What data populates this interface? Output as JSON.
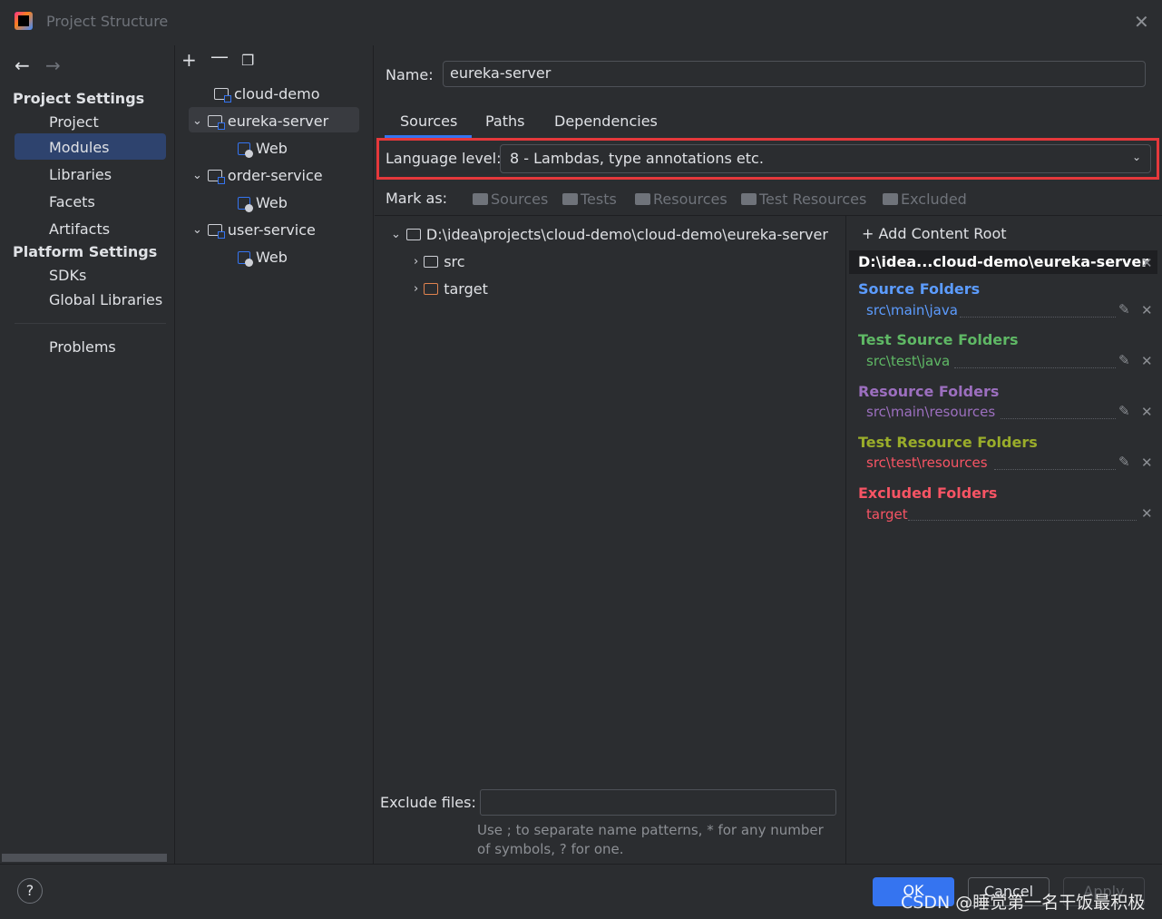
{
  "window": {
    "title": "Project Structure"
  },
  "sidebar": {
    "project_settings": "Project Settings",
    "project_items": [
      "Project",
      "Modules",
      "Libraries",
      "Facets",
      "Artifacts"
    ],
    "platform_settings": "Platform Settings",
    "platform_items": [
      "SDKs",
      "Global Libraries"
    ],
    "problems": "Problems"
  },
  "module_tree": {
    "items": [
      "cloud-demo",
      "eureka-server",
      "Web",
      "order-service",
      "Web",
      "user-service",
      "Web"
    ]
  },
  "main": {
    "name_label": "Name:",
    "name_value": "eureka-server",
    "tabs": [
      "Sources",
      "Paths",
      "Dependencies"
    ],
    "language_level_label": "Language level:",
    "language_level_value": "8 - Lambdas, type annotations etc.",
    "mark_as_label": "Mark as:",
    "mark_as_items": [
      "Sources",
      "Tests",
      "Resources",
      "Test Resources",
      "Excluded"
    ],
    "tree_root": "D:\\idea\\projects\\cloud-demo\\cloud-demo\\eureka-server",
    "tree_children": [
      "src",
      "target"
    ],
    "exclude_files_label": "Exclude files:",
    "exclude_hint": "Use ; to separate name patterns, * for any number of symbols, ? for one."
  },
  "content_root": {
    "add_label": "Add Content Root",
    "root_path": "D:\\idea...cloud-demo\\eureka-server",
    "groups": [
      {
        "title": "Source Folders",
        "path": "src\\main\\java",
        "color": "#5c9cff",
        "path_color": "#5c9cff"
      },
      {
        "title": "Test Source Folders",
        "path": "src\\test\\java",
        "color": "#5fb865",
        "path_color": "#5fb865"
      },
      {
        "title": "Resource Folders",
        "path": "src\\main\\resources",
        "color": "#9c6fbf",
        "path_color": "#9c6fbf"
      },
      {
        "title": "Test Resource Folders",
        "path": "src\\test\\resources",
        "color": "#9aad2a",
        "path_color": "#f75464"
      },
      {
        "title": "Excluded Folders",
        "path": "target",
        "color": "#f75464",
        "path_color": "#f75464"
      }
    ]
  },
  "footer": {
    "help": "?",
    "ok": "OK",
    "cancel": "Cancel",
    "apply": "Apply",
    "watermark": "CSDN @睡觉第一名干饭最积极"
  },
  "colors": {
    "accent": "#3574f0",
    "highlight_box": "#e5383b",
    "selected_bg": "#2e436e"
  }
}
